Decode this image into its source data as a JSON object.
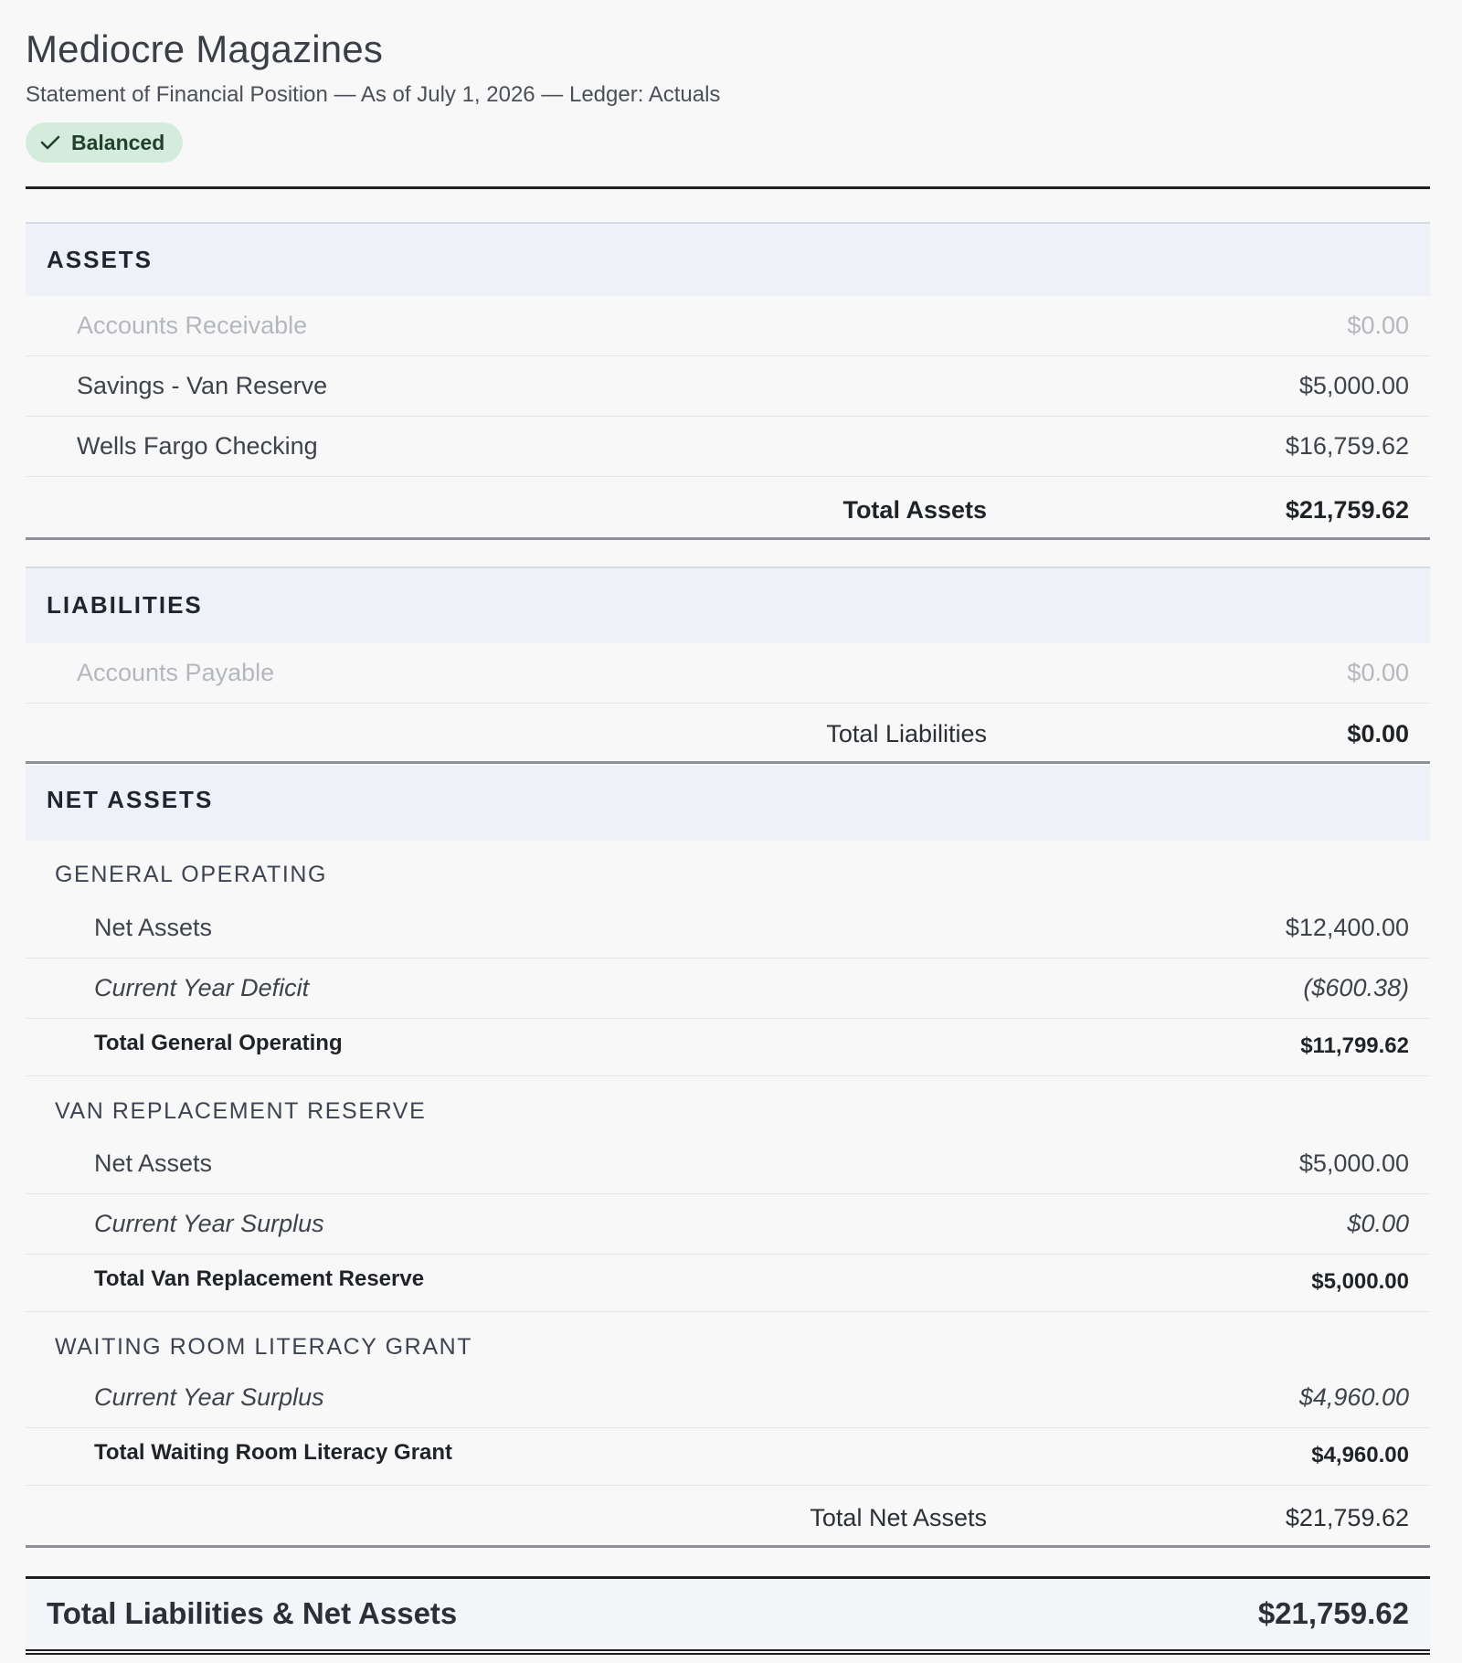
{
  "header": {
    "company": "Mediocre Magazines",
    "subtitle": "Statement of Financial Position — As of July 1, 2026 — Ledger: Actuals",
    "status_badge": "Balanced",
    "status_icon": "check-icon",
    "badge_color": "#d4ecdb"
  },
  "assets": {
    "heading": "ASSETS",
    "rows": [
      {
        "label": "Accounts Receivable",
        "amount": "$0.00"
      },
      {
        "label": "Savings - Van Reserve",
        "amount": "$5,000.00"
      },
      {
        "label": "Wells Fargo Checking",
        "amount": "$16,759.62"
      }
    ],
    "total_label": "Total Assets",
    "total_amount": "$21,759.62"
  },
  "liabilities": {
    "heading": "LIABILITIES",
    "rows": [
      {
        "label": "Accounts Payable",
        "amount": "$0.00"
      }
    ],
    "total_label": "Total Liabilities",
    "total_amount": "$0.00"
  },
  "net_assets": {
    "heading": "NET ASSETS",
    "funds": [
      {
        "name": "GENERAL OPERATING",
        "rows": [
          {
            "label": "Net Assets",
            "amount": "$12,400.00"
          },
          {
            "label": "Current Year Deficit",
            "amount": "($600.38)"
          }
        ],
        "total_label": "Total General Operating",
        "total_amount": "$11,799.62"
      },
      {
        "name": "VAN REPLACEMENT RESERVE",
        "rows": [
          {
            "label": "Net Assets",
            "amount": "$5,000.00"
          },
          {
            "label": "Current Year Surplus",
            "amount": "$0.00"
          }
        ],
        "total_label": "Total Van Replacement Reserve",
        "total_amount": "$5,000.00"
      },
      {
        "name": "WAITING ROOM LITERACY GRANT",
        "rows": [
          {
            "label": "Current Year Surplus",
            "amount": "$4,960.00"
          }
        ],
        "total_label": "Total Waiting Room Literacy Grant",
        "total_amount": "$4,960.00"
      }
    ],
    "total_label": "Total Net Assets",
    "total_amount": "$21,759.62"
  },
  "grand_total": {
    "label": "Total Liabilities & Net Assets",
    "amount": "$21,759.62"
  }
}
